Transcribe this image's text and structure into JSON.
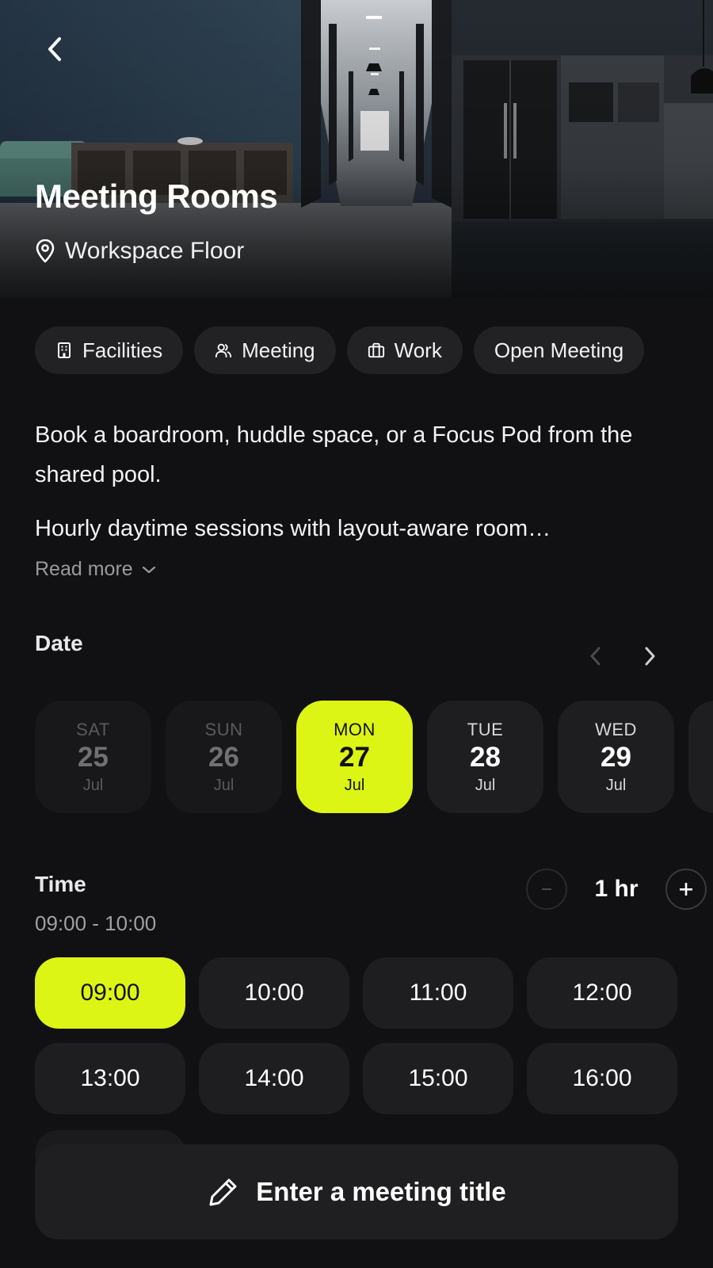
{
  "hero": {
    "title": "Meeting Rooms",
    "location": "Workspace Floor",
    "back_icon": "chevron-left-icon",
    "location_icon": "map-pin-icon"
  },
  "tags": [
    {
      "label": "Facilities",
      "icon": "building-icon"
    },
    {
      "label": "Meeting",
      "icon": "users-icon"
    },
    {
      "label": "Work",
      "icon": "briefcase-icon"
    },
    {
      "label": "Open Meeting",
      "icon": ""
    }
  ],
  "description": {
    "paragraph1": "Book a boardroom, huddle space, or a Focus Pod from the shared pool.",
    "paragraph2": "Hourly daytime sessions with layout-aware room…",
    "read_more": "Read more"
  },
  "date": {
    "label": "Date",
    "days": [
      {
        "dow": "SAT",
        "day": "25",
        "month": "Jul",
        "state": "past"
      },
      {
        "dow": "SUN",
        "day": "26",
        "month": "Jul",
        "state": "past"
      },
      {
        "dow": "MON",
        "day": "27",
        "month": "Jul",
        "state": "selected"
      },
      {
        "dow": "TUE",
        "day": "28",
        "month": "Jul",
        "state": "available"
      },
      {
        "dow": "WED",
        "day": "29",
        "month": "Jul",
        "state": "available"
      }
    ]
  },
  "time": {
    "label": "Time",
    "range": "09:00 - 10:00",
    "duration": "1 hr",
    "slots": [
      "09:00",
      "10:00",
      "11:00",
      "12:00",
      "13:00",
      "14:00",
      "15:00",
      "16:00"
    ],
    "selected_slot": "09:00"
  },
  "meeting_title": {
    "placeholder": "Enter a meeting title",
    "icon": "pencil-icon"
  },
  "colors": {
    "accent": "#dcf515",
    "background": "#111113",
    "card": "#1e1e21"
  }
}
